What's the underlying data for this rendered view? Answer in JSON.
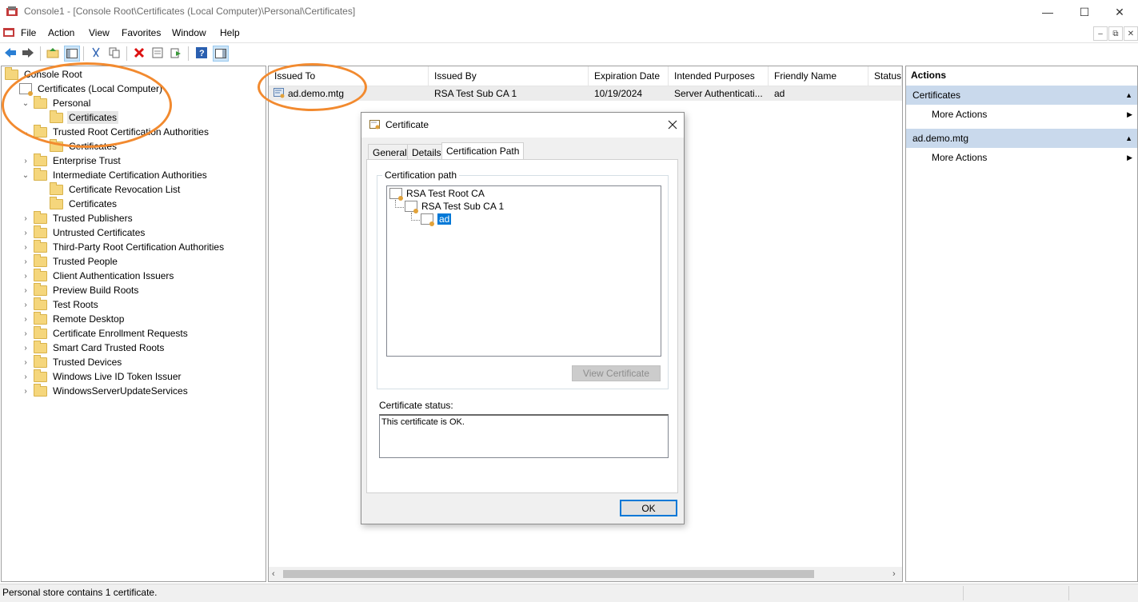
{
  "window": {
    "title": "Console1 - [Console Root\\Certificates (Local Computer)\\Personal\\Certificates]",
    "minimize_glyph": "—",
    "maximize_glyph": "☐",
    "close_glyph": "✕"
  },
  "menu": [
    "File",
    "Action",
    "View",
    "Favorites",
    "Window",
    "Help"
  ],
  "mdi_controls": [
    "–",
    "⧉",
    "✕"
  ],
  "toolbar": {
    "icons": [
      "back-icon",
      "forward-icon",
      "up-folder-icon",
      "show-tree-icon",
      "cut-icon",
      "copy-icon",
      "delete-icon",
      "properties-icon",
      "export-icon",
      "help-icon",
      "show-action-pane-icon"
    ]
  },
  "tree": {
    "root": "Console Root",
    "computer": "Certificates (Local Computer)",
    "personal": "Personal",
    "personal_certs": "Certificates",
    "trusted_root": "Trusted Root Certification Authorities",
    "trusted_root_certs": "Certificates",
    "enterprise_trust": "Enterprise Trust",
    "intermediate": "Intermediate Certification Authorities",
    "crl": "Certificate Revocation List",
    "intermediate_certs": "Certificates",
    "collapsed_stores": [
      "Trusted Publishers",
      "Untrusted Certificates",
      "Third-Party Root Certification Authorities",
      "Trusted People",
      "Client Authentication Issuers",
      "Preview Build Roots",
      "Test Roots",
      "Remote Desktop",
      "Certificate Enrollment Requests",
      "Smart Card Trusted Roots",
      "Trusted Devices",
      "Windows Live ID Token Issuer",
      "WindowsServerUpdateServices"
    ]
  },
  "list": {
    "columns": [
      "Issued To",
      "Issued By",
      "Expiration Date",
      "Intended Purposes",
      "Friendly Name",
      "Status"
    ],
    "rows": [
      {
        "issued_to": "ad.demo.mtg",
        "issued_by": "RSA Test Sub CA 1",
        "expiration": "10/19/2024",
        "purposes": "Server Authenticati...",
        "friendly_name": "ad",
        "status": ""
      }
    ]
  },
  "actions": {
    "header": "Actions",
    "sections": [
      {
        "title": "Certificates",
        "items": [
          "More Actions"
        ]
      },
      {
        "title": "ad.demo.mtg",
        "items": [
          "More Actions"
        ]
      }
    ]
  },
  "status_bar": "Personal store contains 1 certificate.",
  "dialog": {
    "title": "Certificate",
    "tabs": [
      "General",
      "Details",
      "Certification Path"
    ],
    "selected_tab": "Certification Path",
    "path_group_label": "Certification path",
    "path": [
      "RSA Test Root CA",
      "RSA Test Sub CA 1",
      "ad"
    ],
    "view_button": "View Certificate",
    "status_label": "Certificate status:",
    "status_text": "This certificate is OK.",
    "ok_button": "OK"
  },
  "colors": {
    "annotation": "#f28a2f",
    "actions_section_bg": "#c9d9ec",
    "selection_blue": "#0078d7"
  }
}
